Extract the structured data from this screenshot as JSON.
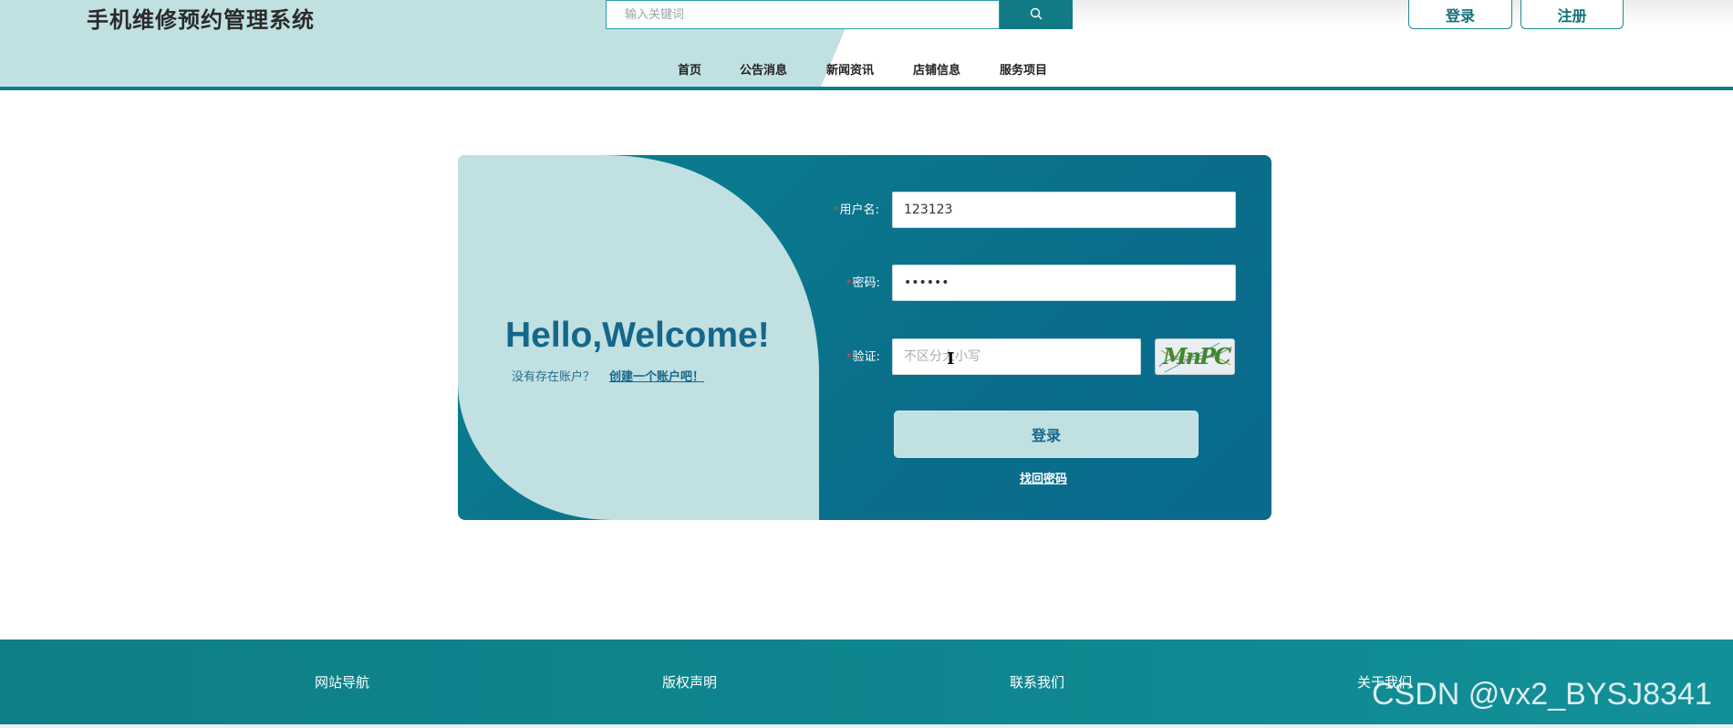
{
  "header": {
    "site_title": "手机维修预约管理系统",
    "search_placeholder": "输入关键词",
    "login_button": "登录",
    "register_button": "注册"
  },
  "nav": {
    "items": [
      "首页",
      "公告消息",
      "新闻资讯",
      "店铺信息",
      "服务项目"
    ]
  },
  "login_card": {
    "welcome_title": "Hello,Welcome!",
    "no_account_text": "没有存在账户？",
    "create_account_link": "创建一个账户吧！",
    "username_label": "用户名:",
    "username_value": "123123",
    "password_label": "密码:",
    "password_value": "123456",
    "captcha_label": "验证:",
    "captcha_placeholder": "不区分大小写",
    "captcha_text": "MnPC",
    "submit_button": "登录",
    "forgot_password_link": "找回密码",
    "field_hint_color": "#1aa04a",
    "required_mark": "*"
  },
  "footer": {
    "items": [
      "网站导航",
      "版权声明",
      "联系我们",
      "关于我们"
    ]
  },
  "watermark": "CSDN @vx2_BYSJ8341",
  "colors": {
    "brand_teal": "#0f7f88",
    "light_teal": "#c1e0e2",
    "dark_blue": "#15678a"
  }
}
